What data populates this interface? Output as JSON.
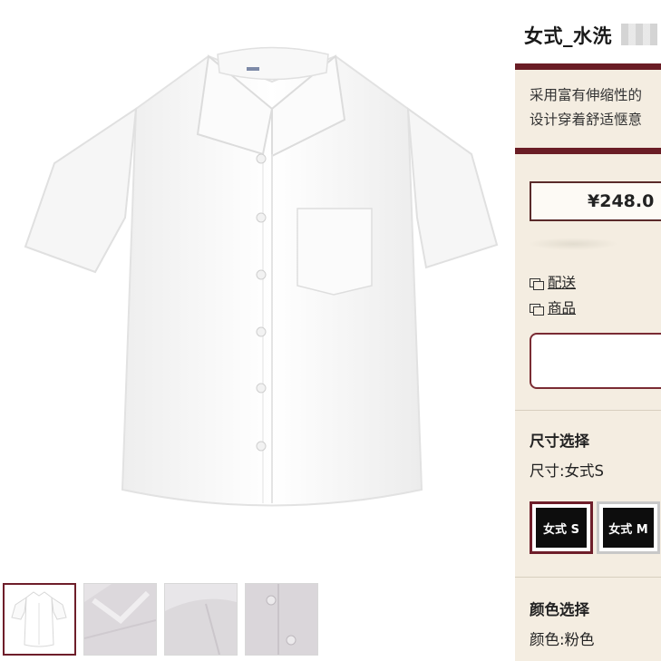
{
  "product": {
    "title": "女式_水洗",
    "description_lines": [
      "采用富有伸缩性的",
      "设计穿着舒适惬意"
    ],
    "price": "¥248.0"
  },
  "links": [
    {
      "icon": "compare-icon",
      "label": "配送"
    },
    {
      "icon": "compare-icon",
      "label": "商品"
    }
  ],
  "size_section": {
    "title": "尺寸选择",
    "selected_label": "尺寸:女式S",
    "options": [
      {
        "label": "女式 S",
        "selected": true
      },
      {
        "label": "女式 M",
        "selected": false
      }
    ]
  },
  "color_section": {
    "title": "颜色选择",
    "selected_label": "颜色:粉色"
  },
  "thumbnails": [
    "white-shirt-front",
    "collar-detail",
    "shoulder-detail",
    "button-detail"
  ],
  "colors": {
    "accent": "#6a1d25",
    "panel_bg": "#f4ede1",
    "shirt": "#ffffff"
  }
}
